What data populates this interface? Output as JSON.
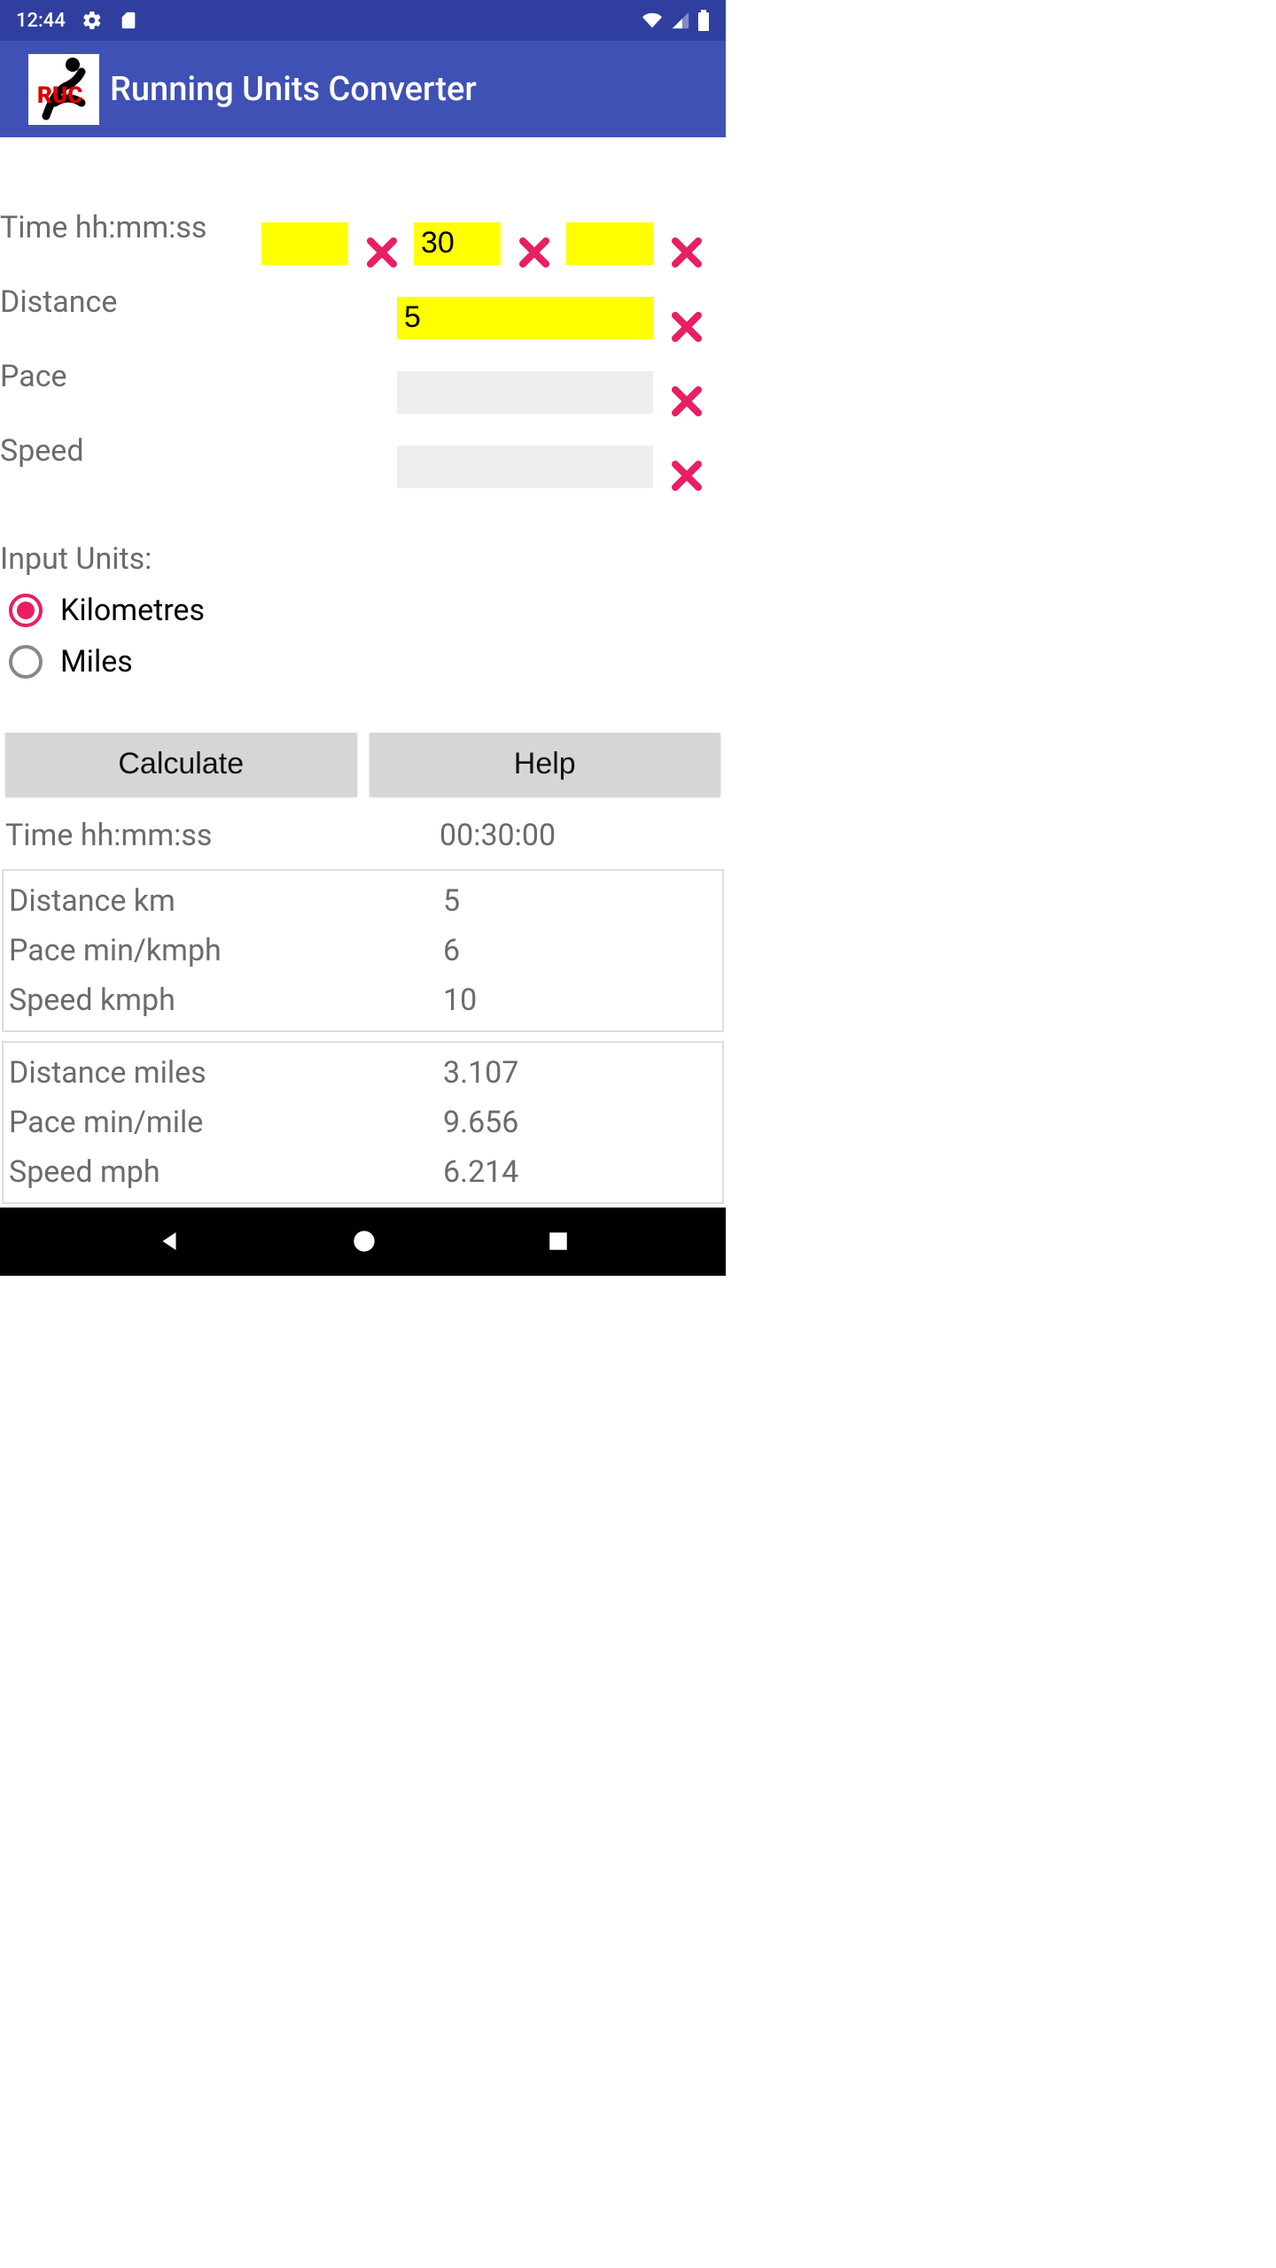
{
  "status": {
    "time": "12:44"
  },
  "header": {
    "title": "Running Units Converter"
  },
  "colors": {
    "accent": "#e91e63",
    "primary": "#3f51b5",
    "primary_dark": "#303f9f",
    "highlight": "#ffff00"
  },
  "inputs": {
    "time_label": "Time hh:mm:ss",
    "time_hh": "",
    "time_mm": "30",
    "time_ss": "",
    "distance_label": "Distance",
    "distance": "5",
    "pace_label": "Pace",
    "pace": "",
    "speed_label": "Speed",
    "speed": ""
  },
  "units": {
    "label": "Input Units:",
    "options": [
      "Kilometres",
      "Miles"
    ],
    "selected": "Kilometres"
  },
  "buttons": {
    "calculate": "Calculate",
    "help": "Help"
  },
  "results": {
    "time_label": "Time hh:mm:ss",
    "time_value": "00:30:00",
    "km": {
      "distance_label": "Distance km",
      "distance": "5",
      "pace_label": "Pace min/kmph",
      "pace": "6",
      "speed_label": "Speed kmph",
      "speed": "10"
    },
    "mi": {
      "distance_label": "Distance miles",
      "distance": "3.107",
      "pace_label": "Pace min/mile",
      "pace": "9.656",
      "speed_label": "Speed mph",
      "speed": "6.214"
    }
  }
}
